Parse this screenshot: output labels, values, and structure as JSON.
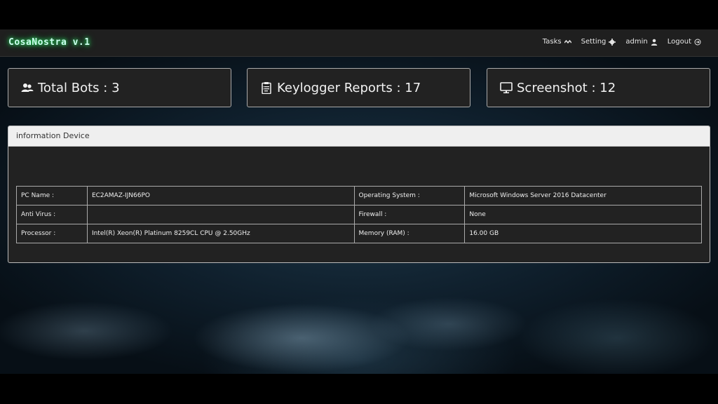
{
  "navbar": {
    "brand": "CosaNostra v.1",
    "links": [
      {
        "label": "Tasks",
        "icon": "chart-line-icon"
      },
      {
        "label": "Setting",
        "icon": "gear-icon"
      },
      {
        "label": "admin",
        "icon": "user-icon"
      },
      {
        "label": "Logout",
        "icon": "logout-icon"
      }
    ]
  },
  "stats": {
    "bots": {
      "label": "Total Bots : 3",
      "icon": "users-icon"
    },
    "keylogger": {
      "label": "Keylogger Reports : 17",
      "icon": "clipboard-icon"
    },
    "screenshot": {
      "label": "Screenshot : 12",
      "icon": "monitor-icon"
    }
  },
  "device_panel": {
    "title": "information Device",
    "rows": [
      {
        "k1": "PC Name :",
        "v1": "EC2AMAZ-IJN66PO",
        "k2": "Operating System :",
        "v2": "Microsoft Windows Server 2016 Datacenter"
      },
      {
        "k1": "Anti Virus :",
        "v1": "",
        "k2": "Firewall :",
        "v2": "None"
      },
      {
        "k1": "Processor :",
        "v1": "Intel(R) Xeon(R) Platinum 8259CL CPU @ 2.50GHz",
        "k2": "Memory (RAM) :",
        "v2": "16.00 GB"
      }
    ]
  }
}
